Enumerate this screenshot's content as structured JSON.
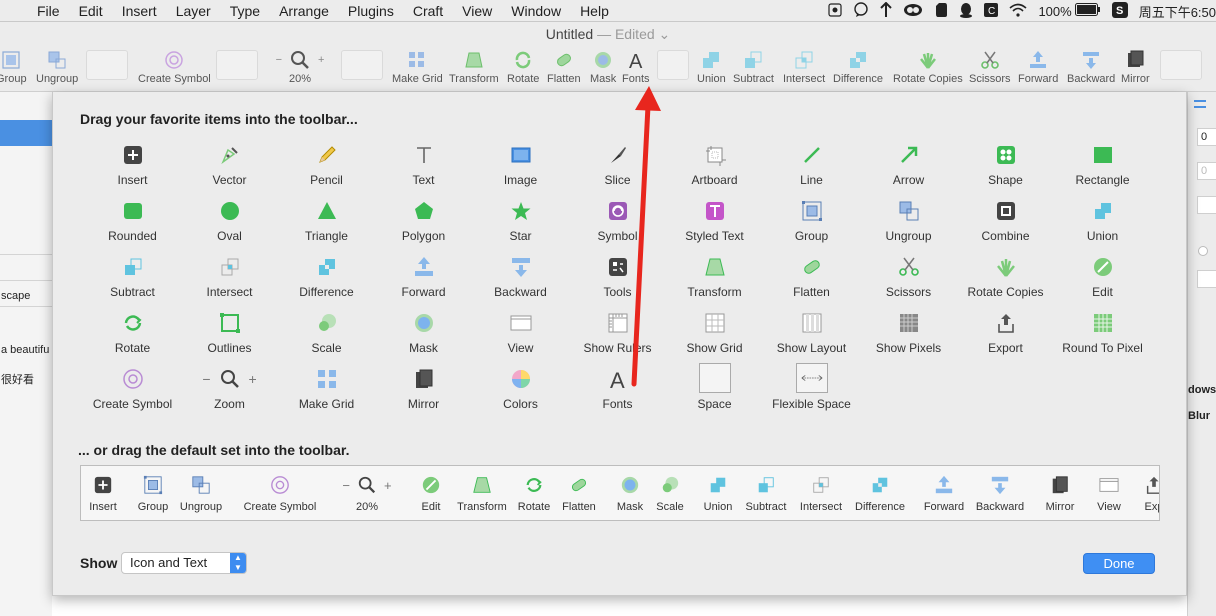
{
  "menubar": {
    "apple": "",
    "items": [
      "File",
      "Edit",
      "Insert",
      "Layer",
      "Type",
      "Arrange",
      "Plugins",
      "Craft",
      "View",
      "Window",
      "Help"
    ],
    "battery": "100%",
    "clock": "周五下午6:50"
  },
  "window": {
    "title": "Untitled",
    "edited": "— Edited"
  },
  "toolbar": {
    "zoom": "20%",
    "items": {
      "group": "Group",
      "ungroup": "Ungroup",
      "create_symbol": "Create Symbol",
      "make_grid": "Make Grid",
      "transform": "Transform",
      "rotate": "Rotate",
      "flatten": "Flatten",
      "mask": "Mask",
      "fonts": "Fonts",
      "union": "Union",
      "subtract": "Subtract",
      "intersect": "Intersect",
      "difference": "Difference",
      "rotate_copies": "Rotate Copies",
      "scissors": "Scissors",
      "forward": "Forward",
      "backward": "Backward",
      "mirror": "Mirror"
    }
  },
  "leftpanel": {
    "text1": "scape",
    "text2": "a beautifu",
    "text3": "很好看"
  },
  "rightpanel": {
    "field1": "0",
    "field2": "0",
    "label1": "dows",
    "label2": "Blur"
  },
  "sheet": {
    "heading1": "Drag your favorite items into the toolbar...",
    "heading2": "... or drag the default set into the toolbar.",
    "palette": [
      "Insert",
      "Vector",
      "Pencil",
      "Text",
      "Image",
      "Slice",
      "Artboard",
      "Line",
      "Arrow",
      "Shape",
      "Rectangle",
      "Rounded",
      "Oval",
      "Triangle",
      "Polygon",
      "Star",
      "Symbol",
      "Styled Text",
      "Group",
      "Ungroup",
      "Combine",
      "Union",
      "Subtract",
      "Intersect",
      "Difference",
      "Forward",
      "Backward",
      "Tools",
      "Transform",
      "Flatten",
      "Scissors",
      "Rotate Copies",
      "Edit",
      "Rotate",
      "Outlines",
      "Scale",
      "Mask",
      "View",
      "Show Rulers",
      "Show Grid",
      "Show Layout",
      "Show Pixels",
      "Export",
      "Round To Pixel",
      "Create Symbol",
      "Zoom",
      "Make Grid",
      "Mirror",
      "Colors",
      "Fonts",
      "Space",
      "Flexible Space"
    ],
    "default_set": [
      "Insert",
      "Group",
      "Ungroup",
      "Create Symbol",
      "20%",
      "Edit",
      "Transform",
      "Rotate",
      "Flatten",
      "Mask",
      "Scale",
      "Union",
      "Subtract",
      "Intersect",
      "Difference",
      "Forward",
      "Backward",
      "Mirror",
      "View",
      "Exp"
    ],
    "show_label": "Show",
    "show_value": "Icon and Text",
    "done": "Done"
  },
  "colors": {
    "accent": "#3f8ff3",
    "icon_green": "#3cba54",
    "icon_blue": "#4a90e2",
    "icon_purple": "#9b59b6",
    "annotation_red": "#e8261e"
  }
}
